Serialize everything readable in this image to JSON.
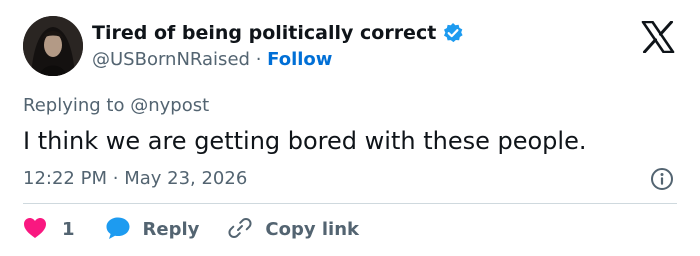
{
  "author": {
    "display_name": "Tired of being politically correct",
    "handle": "@USBornNRaised",
    "separator": "·",
    "follow_label": "Follow",
    "verified_color": "#1d9bf0"
  },
  "reply_context": {
    "prefix": "Replying to",
    "mention": "@nypost"
  },
  "tweet": {
    "text": "I think we are getting bored with these people.",
    "time": "12:22 PM",
    "separator": "·",
    "date": "May 23, 2026"
  },
  "actions": {
    "like_count": "1",
    "reply_label": "Reply",
    "copy_link_label": "Copy link"
  },
  "icons": {
    "brand": "x-logo-icon",
    "info": "info-icon",
    "like": "heart-icon",
    "reply": "speech-bubble-icon",
    "copy": "link-icon"
  },
  "colors": {
    "heart": "#f91880",
    "reply_bubble": "#1d9bf0",
    "link_accent": "#006fd6",
    "muted_text": "#536471",
    "main_text": "#0f1419"
  }
}
